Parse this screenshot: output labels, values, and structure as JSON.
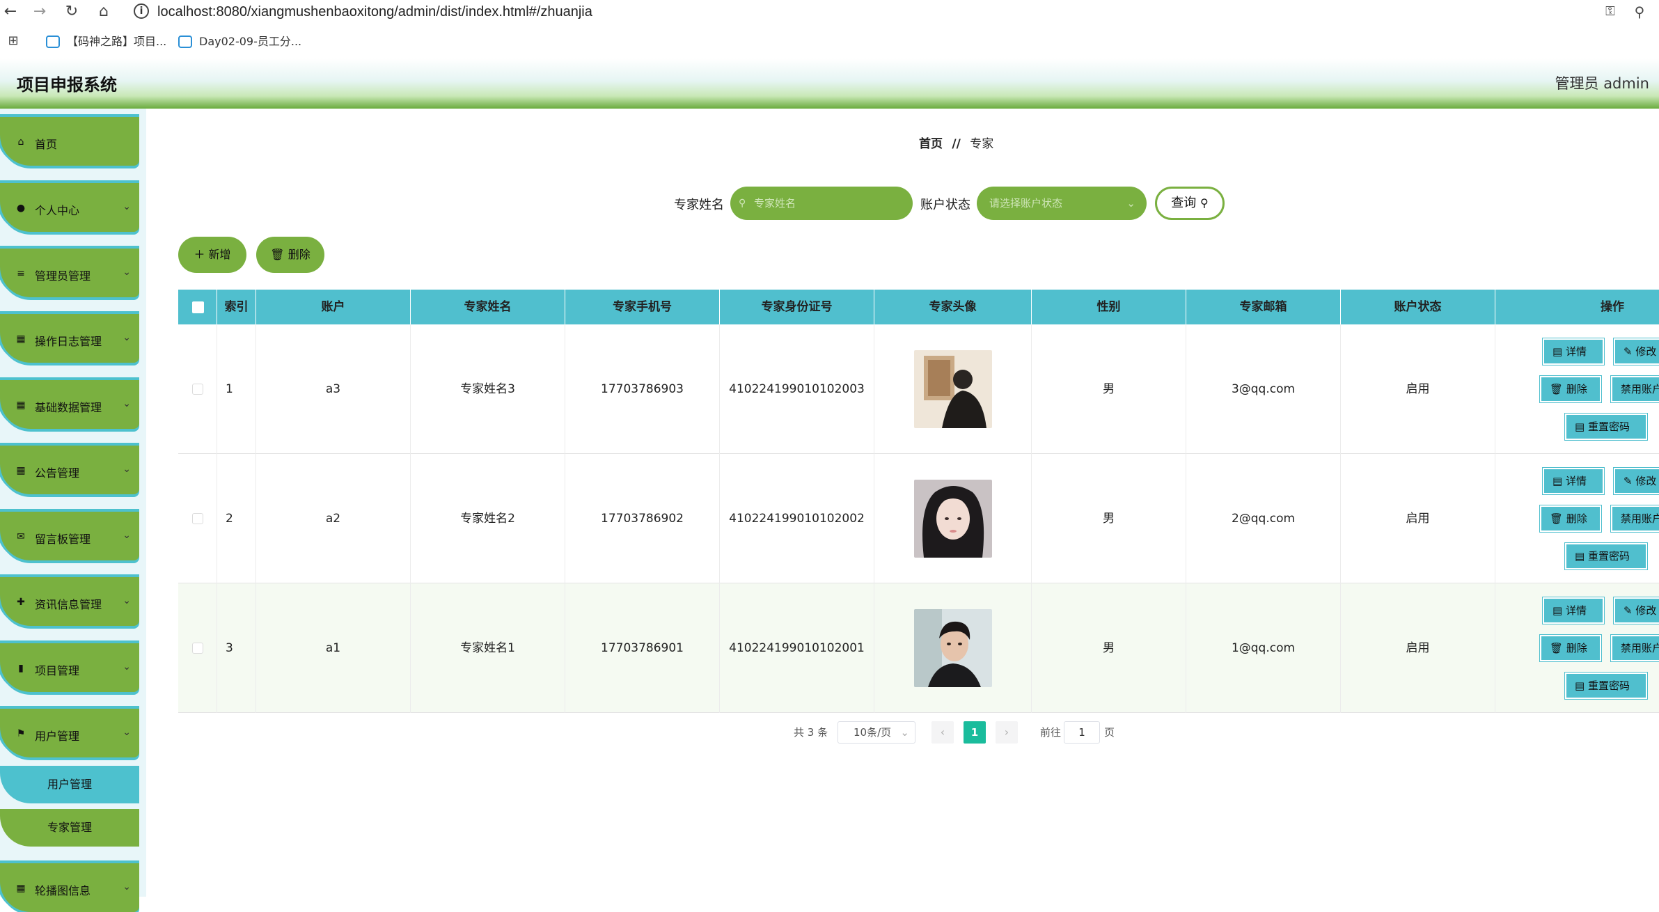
{
  "browser": {
    "url": "localhost:8080/xiangmushenbaoxitong/admin/dist/index.html#/zhuanjia",
    "bookmarks": [
      "【码神之路】项目...",
      "Day02-09-员工分..."
    ]
  },
  "header": {
    "title": "项目申报系统",
    "user": "管理员 admin"
  },
  "sidebar": {
    "items": [
      {
        "label": "首页",
        "icon": "home-icon",
        "expandable": false
      },
      {
        "label": "个人中心",
        "icon": "user-icon",
        "expandable": true
      },
      {
        "label": "管理员管理",
        "icon": "list-icon",
        "expandable": true
      },
      {
        "label": "操作日志管理",
        "icon": "grid-icon",
        "expandable": true
      },
      {
        "label": "基础数据管理",
        "icon": "grid-icon",
        "expandable": true
      },
      {
        "label": "公告管理",
        "icon": "grid-icon",
        "expandable": true
      },
      {
        "label": "留言板管理",
        "icon": "chat-icon",
        "expandable": true
      },
      {
        "label": "资讯信息管理",
        "icon": "like-icon",
        "expandable": true
      },
      {
        "label": "项目管理",
        "icon": "chart-icon",
        "expandable": true
      },
      {
        "label": "用户管理",
        "icon": "flag-icon",
        "expandable": true
      },
      {
        "label": "轮播图信息",
        "icon": "grid-icon",
        "expandable": true
      }
    ],
    "subitems": [
      {
        "label": "用户管理",
        "active": true
      },
      {
        "label": "专家管理",
        "active": false
      }
    ]
  },
  "breadcrumb": {
    "home": "首页",
    "separator": "//",
    "current": "专家"
  },
  "search": {
    "name_label": "专家姓名",
    "name_placeholder": "专家姓名",
    "status_label": "账户状态",
    "status_placeholder": "请选择账户状态",
    "query_label": "查询"
  },
  "actions": {
    "add": "新增",
    "delete": "删除"
  },
  "table": {
    "columns": [
      "索引",
      "账户",
      "专家姓名",
      "专家手机号",
      "专家身份证号",
      "专家头像",
      "性别",
      "专家邮箱",
      "账户状态",
      "操作"
    ],
    "rows": [
      {
        "index": "1",
        "account": "a3",
        "name": "专家姓名3",
        "phone": "17703786903",
        "id_card": "410224199010102003",
        "gender": "男",
        "email": "3@qq.com",
        "status": "启用"
      },
      {
        "index": "2",
        "account": "a2",
        "name": "专家姓名2",
        "phone": "17703786902",
        "id_card": "410224199010102002",
        "gender": "男",
        "email": "2@qq.com",
        "status": "启用"
      },
      {
        "index": "3",
        "account": "a1",
        "name": "专家姓名1",
        "phone": "17703786901",
        "id_card": "410224199010102001",
        "gender": "男",
        "email": "1@qq.com",
        "status": "启用"
      }
    ],
    "op_buttons": {
      "detail": "详情",
      "edit": "修改",
      "delete": "删除",
      "disable": "禁用账户",
      "reset": "重置密码"
    }
  },
  "pagination": {
    "total": "共 3 条",
    "page_size": "10条/页",
    "current": "1",
    "goto_label": "前往",
    "goto_value": "1",
    "page_unit": "页"
  },
  "colors": {
    "accent_green": "#7ab040",
    "accent_teal": "#50bfce",
    "pager_active": "#1abc9c"
  }
}
